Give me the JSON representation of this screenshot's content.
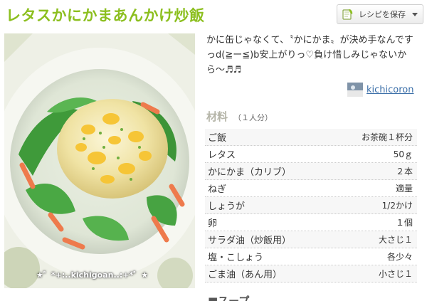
{
  "recipe": {
    "title": "レタスかにかまあんかけ炒飯",
    "description": "かに缶じゃなくて、〝かにかま〟が決め手なんですっd(≧ー≦)b安上がりっ♡負け惜しみじゃないから〜♬♬",
    "photo_watermark": "★゜*+:..kichigoan..:+*゜★"
  },
  "actions": {
    "save_label": "レシピを保存"
  },
  "author": {
    "name": "kichicoron"
  },
  "ingredients": {
    "heading": "材料",
    "servings": "（１人分）",
    "items": [
      {
        "name": "ご飯",
        "amount": "お茶碗１杯分"
      },
      {
        "name": "レタス",
        "amount": "50ｇ"
      },
      {
        "name": "かにかま（カリブ）",
        "amount": "２本"
      },
      {
        "name": "ねぎ",
        "amount": "適量"
      },
      {
        "name": "しょうが",
        "amount": "1/2かけ"
      },
      {
        "name": "卵",
        "amount": "１個"
      },
      {
        "name": "サラダ油（炒飯用）",
        "amount": "大さじ１"
      },
      {
        "name": "塩・こしょう",
        "amount": "各少々"
      },
      {
        "name": "ごま油（あん用）",
        "amount": "小さじ１"
      }
    ],
    "sub_heading": "■スープ"
  },
  "colors": {
    "title_green": "#8cbf1f",
    "link_blue": "#3a6ea8"
  }
}
